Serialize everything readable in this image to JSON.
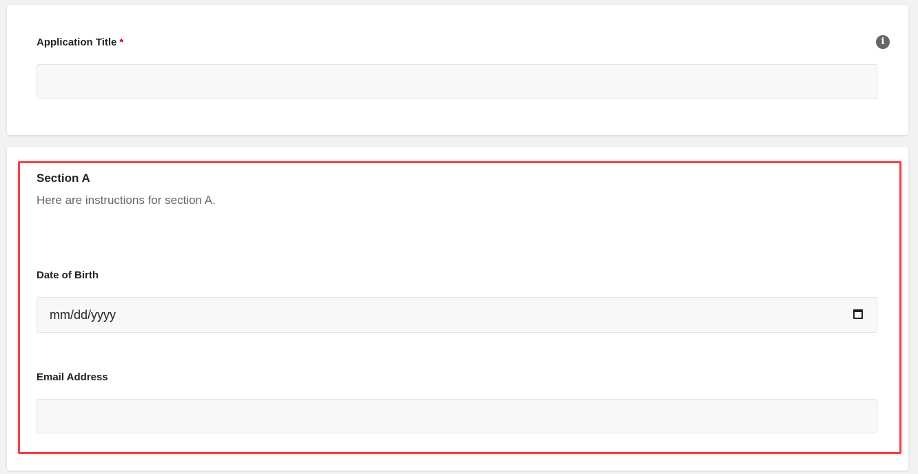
{
  "application_title": {
    "label": "Application Title",
    "required_marker": "*",
    "value": "",
    "info_icon": "info-icon"
  },
  "section_a": {
    "heading": "Section A",
    "instructions": "Here are instructions for section A.",
    "date_of_birth": {
      "label": "Date of Birth",
      "placeholder": "mm/dd/yyyy",
      "icon": "calendar-icon"
    },
    "email_address": {
      "label": "Email Address",
      "value": ""
    }
  },
  "colors": {
    "required": "#d0021b",
    "highlight_border": "#e8434b",
    "field_background": "#f8f8f8",
    "page_background": "#f2f2f2"
  }
}
